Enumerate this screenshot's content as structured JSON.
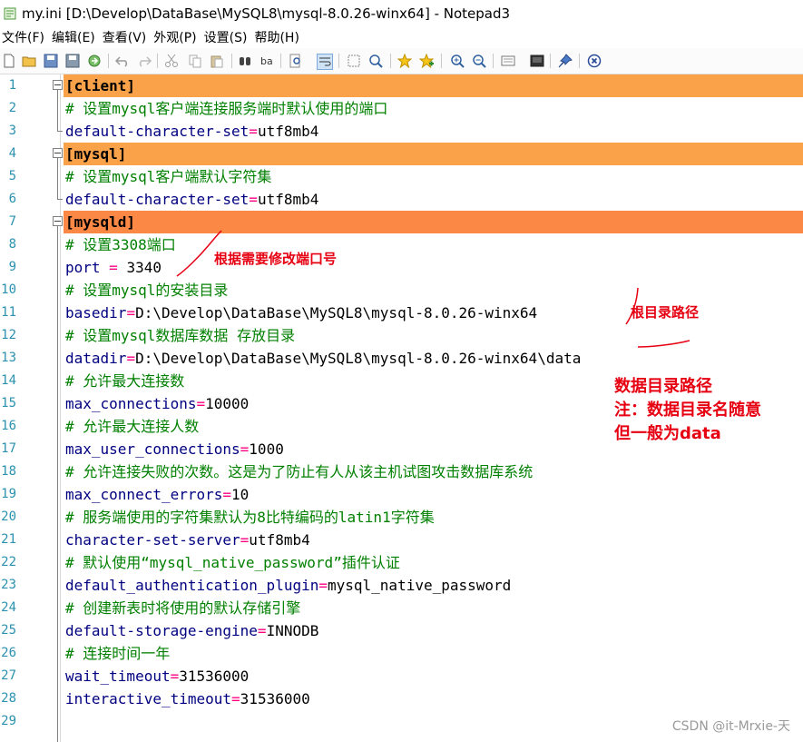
{
  "window": {
    "title": "my.ini [D:\\Develop\\DataBase\\MySQL8\\mysql-8.0.26-winx64] - Notepad3"
  },
  "menu": [
    "文件(F)",
    "编辑(E)",
    "查看(V)",
    "外观(P)",
    "设置(S)",
    "帮助(H)"
  ],
  "toolbar": {
    "icons": [
      "new-file-icon",
      "open-folder-icon",
      "save-icon",
      "save-as-icon",
      "browse-icon",
      "undo-icon",
      "redo-icon",
      "cut-icon",
      "copy-icon",
      "paste-icon",
      "find-icon",
      "replace-icon",
      "find-in-files-icon",
      "word-wrap-icon",
      "select-icon",
      "zoom-fit-icon",
      "favorite-icon",
      "add-favorite-icon",
      "zoom-in-icon",
      "zoom-out-icon",
      "schema-icon",
      "customize-icon",
      "pin-icon",
      "close-icon"
    ]
  },
  "editor": {
    "lines": [
      {
        "n": "1",
        "kind": "section",
        "text": "[client]"
      },
      {
        "n": "2",
        "kind": "comment",
        "text": "# 设置mysql客户端连接服务端时默认使用的端口"
      },
      {
        "n": "3",
        "kind": "kv",
        "key": "default-character-set",
        "eq": "=",
        "val": "utf8mb4"
      },
      {
        "n": "4",
        "kind": "section",
        "text": "[mysql]"
      },
      {
        "n": "5",
        "kind": "comment",
        "text": "# 设置mysql客户端默认字符集"
      },
      {
        "n": "6",
        "kind": "kv",
        "key": "default-character-set",
        "eq": "=",
        "val": "utf8mb4"
      },
      {
        "n": "7",
        "kind": "section-active",
        "text": "[mysqld]"
      },
      {
        "n": "8",
        "kind": "comment",
        "text": "# 设置3308端口"
      },
      {
        "n": "9",
        "kind": "kv",
        "key": "port ",
        "eq": "=",
        "val": " 3340"
      },
      {
        "n": "10",
        "kind": "comment",
        "text": "# 设置mysql的安装目录"
      },
      {
        "n": "11",
        "kind": "kv",
        "key": "basedir",
        "eq": "=",
        "val": "D:\\Develop\\DataBase\\MySQL8\\mysql-8.0.26-winx64"
      },
      {
        "n": "12",
        "kind": "comment",
        "text": "# 设置mysql数据库数据 存放目录"
      },
      {
        "n": "13",
        "kind": "kv",
        "key": "datadir",
        "eq": "=",
        "val": "D:\\Develop\\DataBase\\MySQL8\\mysql-8.0.26-winx64\\data"
      },
      {
        "n": "14",
        "kind": "comment",
        "text": "# 允许最大连接数"
      },
      {
        "n": "15",
        "kind": "kv",
        "key": "max_connections",
        "eq": "=",
        "val": "10000"
      },
      {
        "n": "16",
        "kind": "comment",
        "text": "# 允许最大连接人数"
      },
      {
        "n": "17",
        "kind": "kv",
        "key": "max_user_connections",
        "eq": "=",
        "val": "1000"
      },
      {
        "n": "18",
        "kind": "comment",
        "text": "# 允许连接失败的次数。这是为了防止有人从该主机试图攻击数据库系统"
      },
      {
        "n": "19",
        "kind": "kv",
        "key": "max_connect_errors",
        "eq": "=",
        "val": "10"
      },
      {
        "n": "20",
        "kind": "comment",
        "text": "# 服务端使用的字符集默认为8比特编码的latin1字符集"
      },
      {
        "n": "21",
        "kind": "kv",
        "key": "character-set-server",
        "eq": "=",
        "val": "utf8mb4"
      },
      {
        "n": "22",
        "kind": "comment",
        "text": "# 默认使用“mysql_native_password”插件认证"
      },
      {
        "n": "23",
        "kind": "kv",
        "key": "default_authentication_plugin",
        "eq": "=",
        "val": "mysql_native_password"
      },
      {
        "n": "24",
        "kind": "comment",
        "text": "# 创建新表时将使用的默认存储引擎"
      },
      {
        "n": "25",
        "kind": "kv",
        "key": "default-storage-engine",
        "eq": "=",
        "val": "INNODB"
      },
      {
        "n": "26",
        "kind": "comment",
        "text": "# 连接时间一年"
      },
      {
        "n": "27",
        "kind": "kv",
        "key": "wait_timeout",
        "eq": "=",
        "val": "31536000"
      },
      {
        "n": "28",
        "kind": "kv",
        "key": "interactive_timeout",
        "eq": "=",
        "val": "31536000"
      },
      {
        "n": "29",
        "kind": "empty",
        "text": ""
      }
    ]
  },
  "annotations": {
    "port_note": "根据需要修改端口号",
    "basedir_note": "根目录路径",
    "datadir_note_1": "数据目录路径",
    "datadir_note_2": "注：数据目录名随意",
    "datadir_note_3": "但一般为data",
    "color": "#e60012"
  },
  "watermark": "CSDN @it-Mrxie-天",
  "colors": {
    "section_bg": "#f9a24a",
    "active_section_bg": "#fb8845",
    "comment": "#008000",
    "key": "#000080",
    "equals": "#ff0080",
    "line_number": "#2b91af"
  }
}
